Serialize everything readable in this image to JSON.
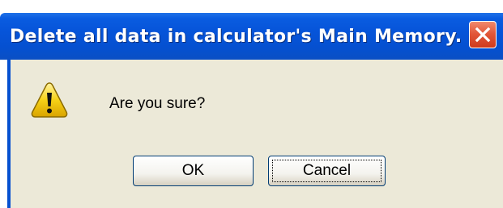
{
  "dialog": {
    "title": "Delete all data in calculator's Main Memory.",
    "close_icon": "close-icon",
    "message": "Are you sure?",
    "icon": "warning-icon",
    "buttons": {
      "ok_label": "OK",
      "cancel_label": "Cancel"
    },
    "colors": {
      "titlebar": "#0550d0",
      "close_button": "#e2583a",
      "body_background": "#ece9d8",
      "warning_fill": "#f7d117"
    }
  }
}
